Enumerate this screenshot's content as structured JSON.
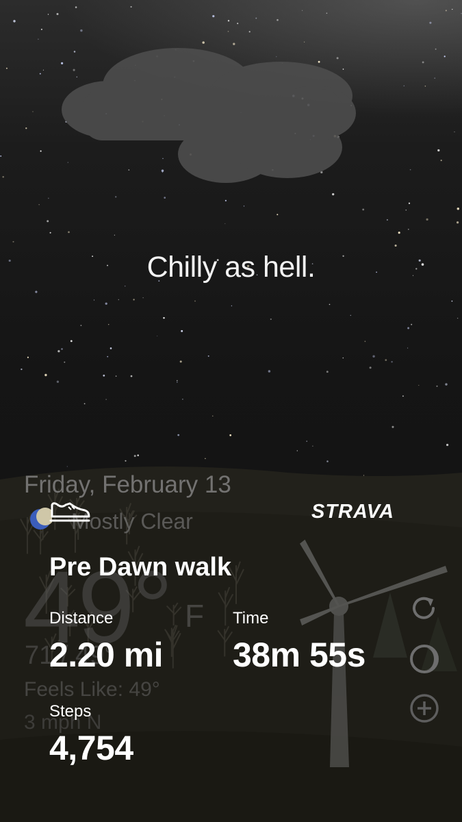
{
  "wallpaper": {
    "caption": "Chilly as hell."
  },
  "weather_widget": {
    "date": "Friday, February 13",
    "condition": "Mostly Clear",
    "temperature": "49°",
    "unit": "F",
    "hi_lo": "71 / 49°",
    "feels_like": "Feels Like: 49°",
    "wind": "3 mph N",
    "condition_icon": "moon-icon"
  },
  "strava": {
    "logo_text": "STRAVA",
    "activity_icon": "shoe-icon",
    "activity_title": "Pre Dawn walk",
    "stats": {
      "distance_label": "Distance",
      "distance_value": "2.20 mi",
      "time_label": "Time",
      "time_value": "38m 55s",
      "steps_label": "Steps",
      "steps_value": "4,754"
    }
  },
  "side_controls": {
    "refresh_icon": "refresh-icon",
    "moon_phase_icon": "moon-phase-icon",
    "add_icon": "plus-circle-icon"
  },
  "colors": {
    "text_primary": "#ffffff",
    "sky": "#151515",
    "faded_text": "#8a8a8a"
  }
}
